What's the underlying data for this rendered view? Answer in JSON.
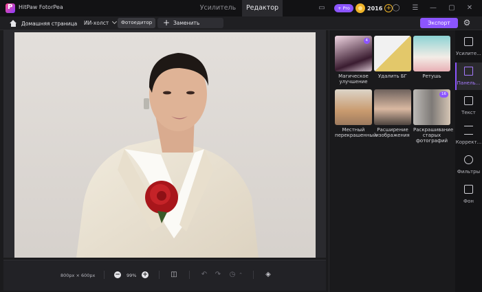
{
  "app": {
    "title": "HitPaw FotorPea"
  },
  "top_tabs": [
    {
      "label": "Усилитель"
    },
    {
      "label": "Редактор"
    }
  ],
  "header": {
    "pro_label": "+ Pro",
    "credits": "2016"
  },
  "toolbar": {
    "home": "Домашняя страница",
    "ai_canvas": "ИИ-холст",
    "photo_editor": "Фотоедитор",
    "replace": "Заменить картинку",
    "export": "Экспорт"
  },
  "canvas": {
    "size": "800px × 600px",
    "zoom": "99%"
  },
  "tools": [
    {
      "label": "Магическое улучшение",
      "badge": "4"
    },
    {
      "label": "Удалить БГ"
    },
    {
      "label": "Ретушь"
    },
    {
      "label": "Местный перекрашенный"
    },
    {
      "label": "Расширение изображения"
    },
    {
      "label": "Раскрашивание старых фотографий",
      "badge": "16"
    }
  ],
  "rail": [
    {
      "label": "Усилите..."
    },
    {
      "label": "Панель..."
    },
    {
      "label": "Текст"
    },
    {
      "label": "Коррект..."
    },
    {
      "label": "Фильтры"
    },
    {
      "label": "Фон"
    }
  ],
  "colors": {
    "accent": "#8c55ff",
    "coin": "#f0b429"
  }
}
